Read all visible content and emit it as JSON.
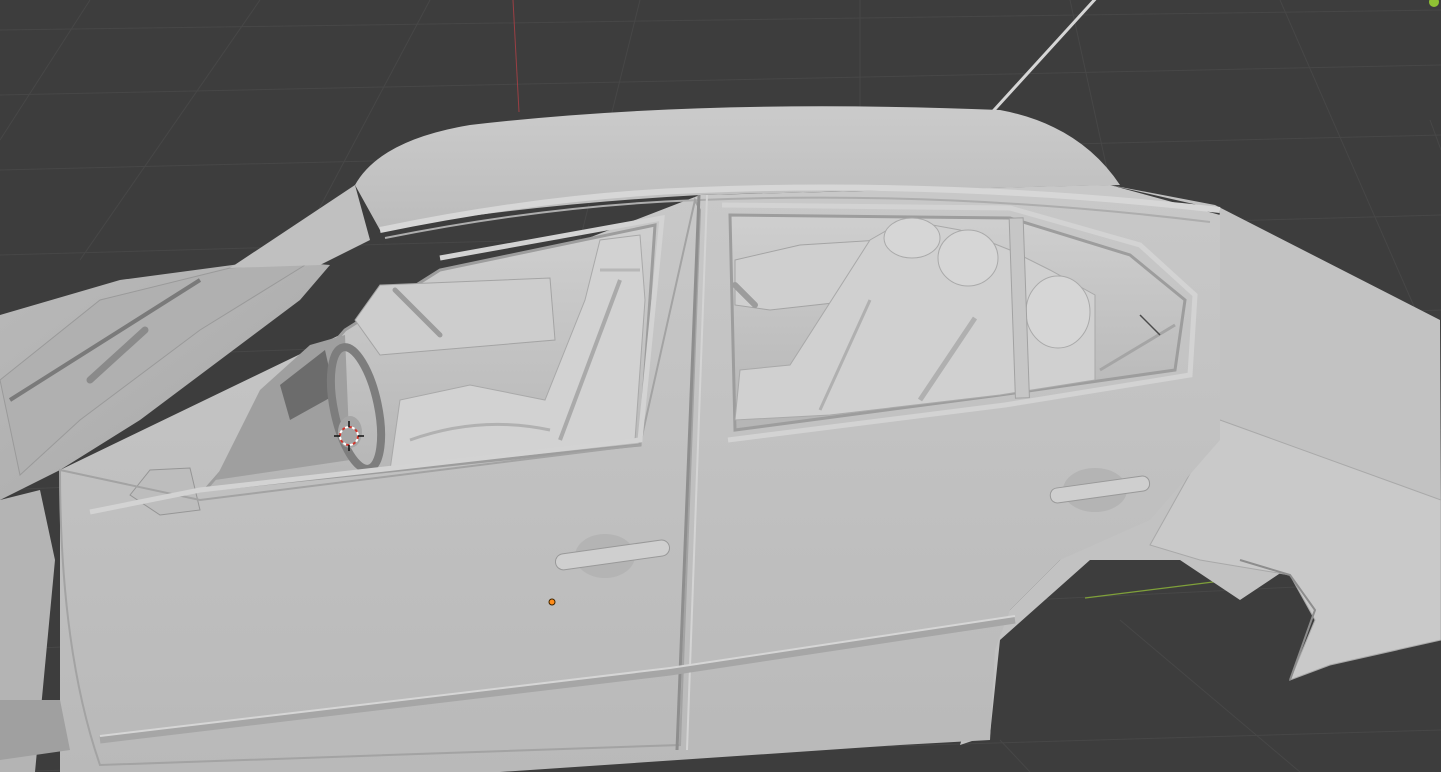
{
  "viewport": {
    "mode": "solid-shading",
    "background": "#3d3d3d",
    "grid_color": "#474747",
    "model_base_color": "#c4c4c4",
    "x_axis_color": "#9a3f44",
    "y_axis_color": "#7fa03a",
    "origin_color": "#ff8c19",
    "cursor_colors": [
      "#d0362d",
      "#ffffff"
    ]
  },
  "objects": {
    "model": "car-body",
    "parts": [
      "roof",
      "antenna",
      "front-door",
      "rear-door",
      "front-seat",
      "rear-seat",
      "steering-wheel",
      "dashboard",
      "side-mirror",
      "door-handles",
      "hood",
      "rear-fender"
    ]
  }
}
